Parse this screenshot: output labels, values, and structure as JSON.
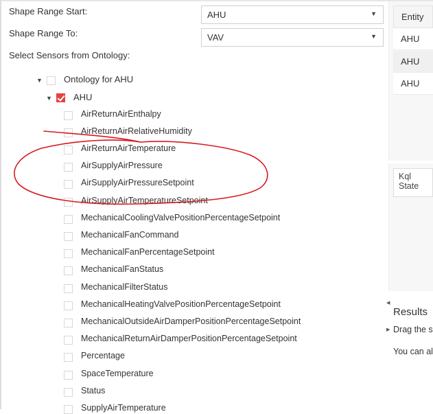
{
  "form": {
    "shape_range_start_label": "Shape Range Start:",
    "shape_range_start_value": "AHU",
    "shape_range_to_label": "Shape Range To:",
    "shape_range_to_value": "VAV",
    "select_sensors_label": "Select Sensors from Ontology:"
  },
  "tree": {
    "root_label": "Ontology for AHU",
    "ahu_label": "AHU",
    "items": [
      "AirReturnAirEnthalpy",
      "AirReturnAirRelativeHumidity",
      "AirReturnAirTemperature",
      "AirSupplyAirPressure",
      "AirSupplyAirPressureSetpoint",
      "AirSupplyAirTemperatureSetpoint",
      "MechanicalCoolingValvePositionPercentageSetpoint",
      "MechanicalFanCommand",
      "MechanicalFanPercentageSetpoint",
      "MechanicalFanStatus",
      "MechanicalFilterStatus",
      "MechanicalHeatingValvePositionPercentageSetpoint",
      "MechanicalOutsideAirDamperPositionPercentageSetpoint",
      "MechanicalReturnAirDamperPositionPercentageSetpoint",
      "Percentage",
      "SpaceTemperature",
      "Status",
      "SupplyAirTemperature"
    ]
  },
  "entity_grid": {
    "header": "Entity",
    "rows": [
      "AHU",
      "AHU",
      "AHU"
    ]
  },
  "kql": {
    "placeholder": "Kql State"
  },
  "results": {
    "title": "Results",
    "line1": "Drag the s",
    "line2": "You can al"
  },
  "colors": {
    "checkbox_checked": "#e84141",
    "annotation": "#d9181e"
  },
  "icons": {
    "dropdown": "triangle-down",
    "expand": "triangle-down",
    "collapse_arrow": "triangle-left"
  }
}
